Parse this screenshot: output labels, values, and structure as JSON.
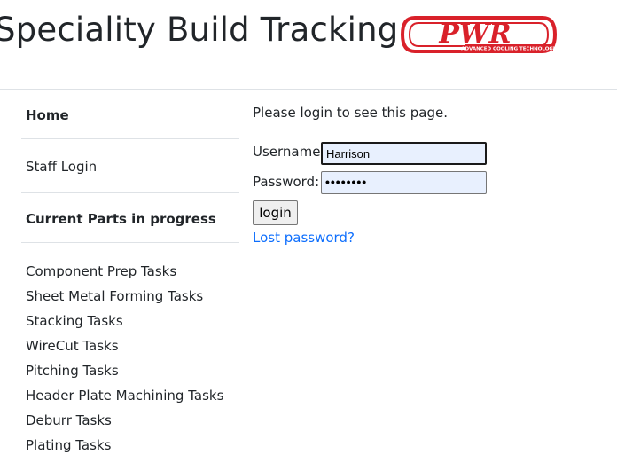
{
  "header": {
    "title": "Speciality Build Tracking",
    "logo_text": "PWR",
    "logo_tagline": "ADVANCED COOLING TECHNOLOGY",
    "logo_color": "#d9212a"
  },
  "sidebar": {
    "home": "Home",
    "staff_login": "Staff Login",
    "current_parts": "Current Parts in progress",
    "tasks": [
      "Component Prep Tasks",
      "Sheet Metal Forming Tasks",
      "Stacking Tasks",
      "WireCut Tasks",
      "Pitching Tasks",
      "Header Plate Machining Tasks",
      "Deburr Tasks",
      "Plating Tasks"
    ]
  },
  "login": {
    "message": "Please login to see this page.",
    "username_label": "Username:",
    "username_value": "Harrison",
    "password_label": "Password:",
    "password_value": "••••••••",
    "button_label": "login",
    "lost_password": "Lost password?"
  }
}
